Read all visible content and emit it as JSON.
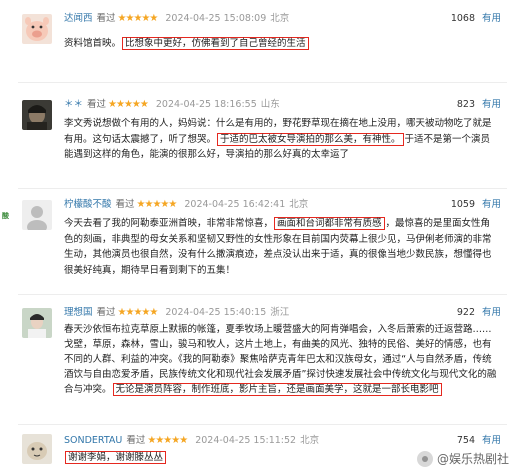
{
  "reviews": [
    {
      "user": "达闻西",
      "watched": "看过",
      "stars": "★★★★★",
      "date": "2024-04-25 15:08:09",
      "location": "北京",
      "votes": "1068",
      "useful": "有用",
      "text_before": "资料馆首映。",
      "highlight": "比想象中更好，仿佛看到了自己曾经的生活",
      "text_after": ""
    },
    {
      "user": "＊＊",
      "watched": "看过",
      "stars": "★★★★★",
      "date": "2024-04-25 18:16:55",
      "location": "山东",
      "votes": "823",
      "useful": "有用",
      "text_before": "李文秀说想做个有用的人，妈妈说：什么是有用的，野花野草现在摘在地上没用，哪天被动物吃了就是有用。这句话太震撼了，听了想哭。",
      "highlight": "于适的巴太被女导演拍的那么美，有神性。",
      "text_after": "于适不是第一个演员能遇到这样的角色，能演的很那么好，导演拍的那么好真的太幸运了"
    },
    {
      "user": "柠檬酸不酸",
      "watched": "看过",
      "stars": "★★★★★",
      "date": "2024-04-25 16:42:41",
      "location": "北京",
      "votes": "1059",
      "useful": "有用",
      "text_before": "今天去看了我的阿勒泰亚洲首映，非常非常惊喜，",
      "highlight": "画面和台词都非常有质感",
      "text_after": "，最惊喜的是里面女性角色的刻画，非典型的母女关系和坚韧又野性的女性形象在目前国内荧幕上很少见，马伊俐老师演的非常生动，其他演员也很自然，没有什么撒演痕迹，差点没认出来于适，真的很像当地少数民族，想懂得也很美好纯真，期待早日看到剩下的五集！"
    },
    {
      "user": "理想国",
      "watched": "看过",
      "stars": "★★★★★",
      "date": "2024-04-25 15:40:15",
      "location": "浙江",
      "votes": "922",
      "useful": "有用",
      "text_before": "春天沙依恒布拉克草原上默振的帐篷，夏季牧场上暖营盛大的阿肯弹唱会，入冬后萧索的迁返营路……戈壁，草原，森林，雪山，骏马和牧人，这片土地上，有曲美的风光、独特的民俗、美好的情感，也有不同的人群、利益的冲突。《我的阿勒泰》聚焦哈萨克青年巴太和汉族母女，通过“人与自然矛盾，传统酒饮与自由恋爱矛盾，民族传统文化和现代社会发展矛盾”探讨快速发展社会中传统文化与现代文化的融合与冲突。",
      "highlight": "无论是演员阵容，制作班底，影片主旨，还是画面美学，这就是一部长电影吧",
      "text_after": ""
    },
    {
      "user": "SONDERTAU",
      "watched": "看过",
      "stars": "★★★★★",
      "date": "2024-04-25 15:11:52",
      "location": "北京",
      "votes": "754",
      "useful": "有用",
      "text_before": "",
      "highlight": "谢谢李娟，谢谢滕丛丛",
      "text_after": ""
    }
  ],
  "side_label": "酸",
  "watermark": "@娱乐热剧社",
  "colors": {
    "highlight_border": "#e5281f",
    "star": "#f5a623",
    "link": "#3377aa"
  }
}
